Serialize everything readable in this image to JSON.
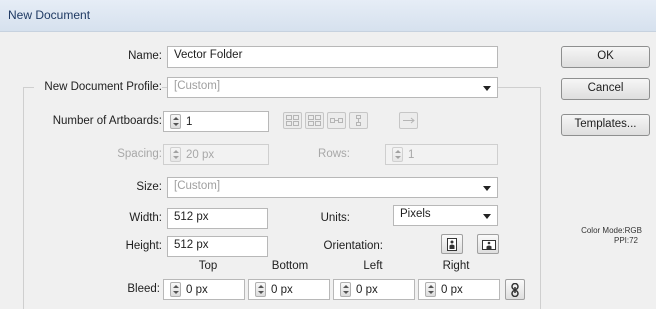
{
  "window": {
    "title": "New Document"
  },
  "form": {
    "name_label": "Name:",
    "name_value": "Vector Folder",
    "profile_label": "New Document Profile:",
    "profile_value": "[Custom]",
    "artboards_label": "Number of Artboards:",
    "artboards_value": "1",
    "spacing_label": "Spacing:",
    "spacing_value": "20 px",
    "rows_label": "Rows:",
    "rows_value": "1",
    "size_label": "Size:",
    "size_value": "[Custom]",
    "width_label": "Width:",
    "width_value": "512 px",
    "units_label": "Units:",
    "units_value": "Pixels",
    "height_label": "Height:",
    "height_value": "512 px",
    "orientation_label": "Orientation:",
    "bleed_label": "Bleed:",
    "bleed": [
      {
        "header": "Top",
        "value": "0 px"
      },
      {
        "header": "Bottom",
        "value": "0 px"
      },
      {
        "header": "Left",
        "value": "0 px"
      },
      {
        "header": "Right",
        "value": "0 px"
      }
    ]
  },
  "buttons": {
    "ok": "OK",
    "cancel": "Cancel",
    "templates": "Templates..."
  },
  "info": {
    "color_mode": "Color Mode:RGB",
    "ppi": "PPI:72"
  },
  "icons": [
    "spinner-icon",
    "grid-by-row-icon",
    "grid-by-column-icon",
    "arrange-by-row-icon",
    "arrange-by-column-icon",
    "right-to-left-icon",
    "portrait-icon",
    "landscape-icon",
    "link-bleed-icon"
  ],
  "colors": {
    "title_bar": "#dbe5f1",
    "title_text": "#1f3a63",
    "dialog_bg": "#f0f0f0"
  }
}
